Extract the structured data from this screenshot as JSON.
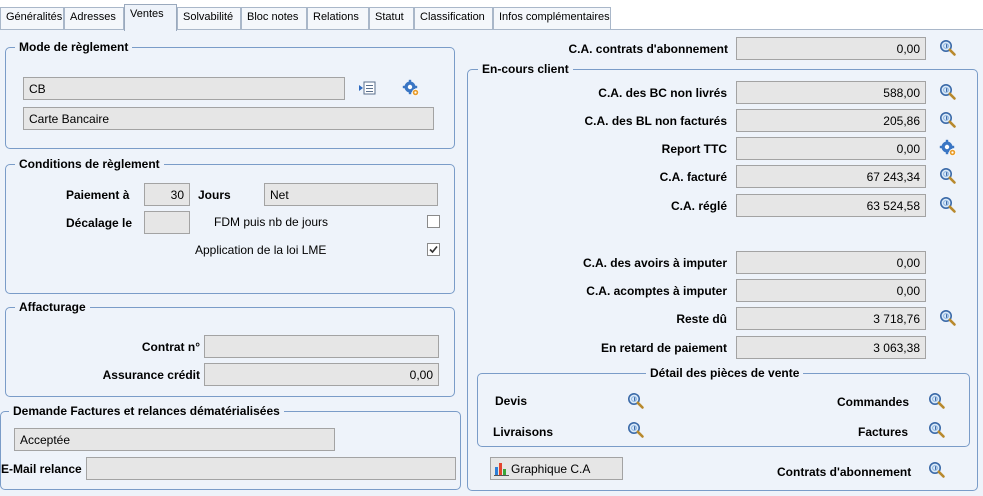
{
  "tabs": [
    {
      "label": "Généralités"
    },
    {
      "label": "Adresses"
    },
    {
      "label": "Ventes"
    },
    {
      "label": "Solvabilité"
    },
    {
      "label": "Bloc notes"
    },
    {
      "label": "Relations"
    },
    {
      "label": "Statut"
    },
    {
      "label": "Classification"
    },
    {
      "label": "Infos complémentaires"
    }
  ],
  "mode_reglement": {
    "title": "Mode de règlement",
    "code": "CB",
    "libelle": "Carte Bancaire"
  },
  "conditions": {
    "title": "Conditions de règlement",
    "paiement_label": "Paiement  à",
    "paiement_value": "30",
    "jours_label": "Jours",
    "net_value": "Net",
    "decalage_label": "Décalage le",
    "decalage_value": "",
    "fdm_label": "FDM puis nb de jours",
    "fdm_checked": false,
    "lme_label": "Application de la loi LME",
    "lme_checked": true
  },
  "affacturage": {
    "title": "Affacturage",
    "contrat_label": "Contrat n°",
    "contrat_value": "",
    "assurance_label": "Assurance crédit",
    "assurance_value": "0,00"
  },
  "demande": {
    "title": "Demande Factures et relances dématérialisées",
    "status": "Acceptée",
    "email_label": "E-Mail relance",
    "email_value": ""
  },
  "right": {
    "ca_contrats_label": "C.A. contrats d'abonnement",
    "ca_contrats_value": "0,00",
    "en_cours": {
      "title": "En-cours client",
      "rows": [
        {
          "label": "C.A. des BC non livrés",
          "value": "588,00",
          "icon": "magnifier-icon"
        },
        {
          "label": "C.A. des BL non facturés",
          "value": "205,86",
          "icon": "magnifier-icon"
        },
        {
          "label": "Report TTC",
          "value": "0,00",
          "icon": "settings-icon"
        },
        {
          "label": "C.A. facturé",
          "value": "67 243,34",
          "icon": "magnifier-icon"
        },
        {
          "label": "C.A. réglé",
          "value": "63 524,58",
          "icon": "magnifier-icon"
        },
        {
          "label": "C.A. des avoirs à imputer",
          "value": "0,00",
          "icon": ""
        },
        {
          "label": "C.A. acomptes à imputer",
          "value": "0,00",
          "icon": ""
        },
        {
          "label": "Reste dû",
          "value": "3 718,76",
          "icon": "magnifier-icon"
        },
        {
          "label": "En retard de paiement",
          "value": "3 063,38",
          "icon": ""
        }
      ]
    },
    "detail": {
      "title": "Détail des pièces de vente",
      "devis": "Devis",
      "commandes": "Commandes",
      "livraisons": "Livraisons",
      "factures": "Factures"
    },
    "graph_button": "Graphique C.A",
    "contrats_label": "Contrats d'abonnement"
  }
}
